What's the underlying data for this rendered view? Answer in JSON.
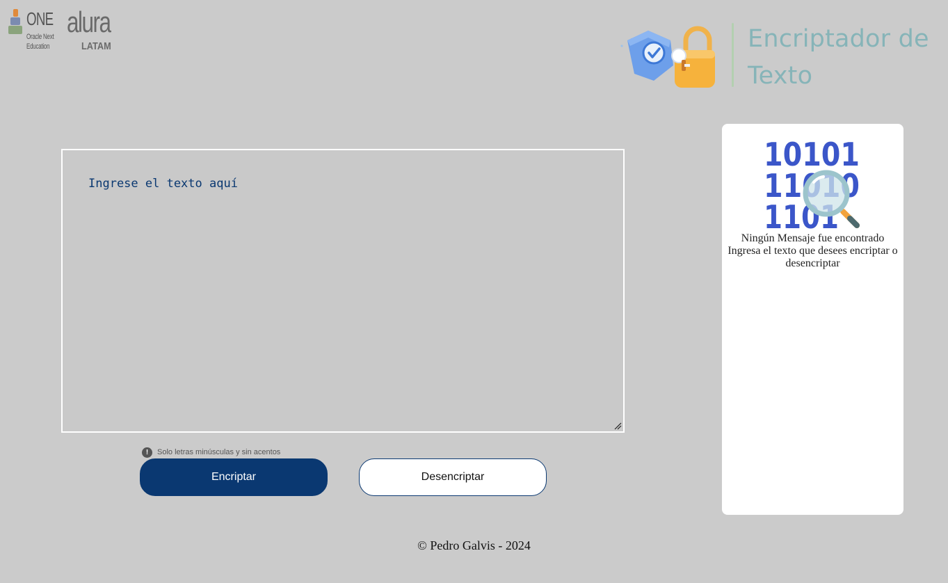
{
  "header": {
    "one_logo": {
      "word": "ONE",
      "subtitle_line1": "Oracle Next",
      "subtitle_line2": "Education"
    },
    "alura_logo": {
      "word": "alura",
      "sub": "LATAM"
    },
    "title": "Encriptador de Texto"
  },
  "input": {
    "placeholder": "Ingrese el texto aquí",
    "value": ""
  },
  "hint": {
    "icon": "!",
    "text": "Solo letras minúsculas y sin acentos"
  },
  "buttons": {
    "encrypt_label": "Encriptar",
    "decrypt_label": "Desencriptar"
  },
  "output": {
    "binary_rows": [
      "10101",
      "11010",
      "1101"
    ],
    "title": "Ningún Mensaje fue encontrado",
    "subtitle": "Ingresa el texto que desees encriptar o desencriptar"
  },
  "footer": {
    "text": "© Pedro Galvis - 2024"
  },
  "colors": {
    "background": "#cbcbcb",
    "primary": "#0a3871",
    "title": "#86b4b8",
    "binary": "#3b56c9"
  }
}
